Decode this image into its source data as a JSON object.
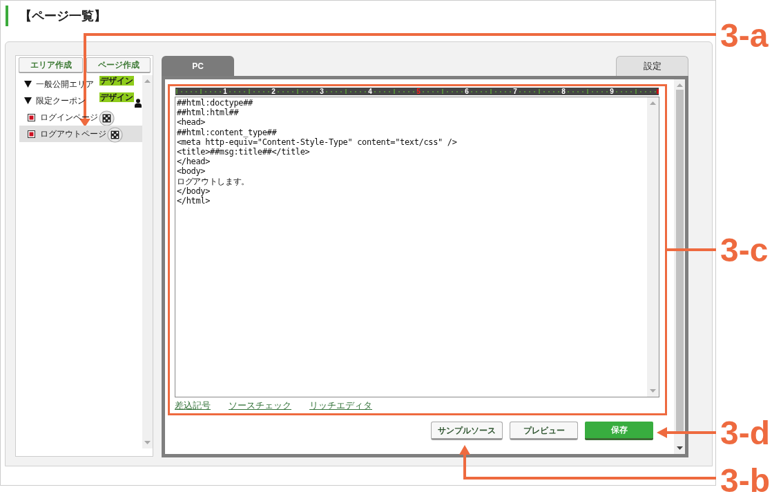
{
  "page_title": "【ページ一覧】",
  "sidebar": {
    "buttons": [
      "エリア作成",
      "ページ作成"
    ],
    "tree": [
      {
        "kind": "folder",
        "label": "一般公開エリア",
        "expanded": true,
        "selected": false,
        "badge": "デザイン",
        "members_only": false
      },
      {
        "kind": "folder",
        "label": "限定クーポン",
        "expanded": true,
        "selected": false,
        "badge": "デザイン",
        "members_only": true,
        "children": [
          {
            "kind": "page",
            "label": "ログインページ",
            "selected": false
          },
          {
            "kind": "page",
            "label": "ログアウトページ",
            "selected": true
          }
        ]
      }
    ]
  },
  "editor": {
    "tabs": [
      {
        "label": "PC",
        "selected": true
      },
      {
        "label": "設定",
        "selected": false
      }
    ],
    "ruler": {
      "marks": [
        {
          "label": "1",
          "highlighted": false
        },
        {
          "label": "2",
          "highlighted": false
        },
        {
          "label": "3",
          "highlighted": false
        },
        {
          "label": "4",
          "highlighted": false
        },
        {
          "label": "5",
          "highlighted": true
        },
        {
          "label": "6",
          "highlighted": false
        },
        {
          "label": "7",
          "highlighted": false
        },
        {
          "label": "8",
          "highlighted": false
        },
        {
          "label": "9",
          "highlighted": false
        }
      ]
    },
    "code_lines": [
      "##html:doctype##",
      "##html:html##",
      "<head>",
      "##html:content_type##",
      "<meta http-equiv=\"Content-Style-Type\" content=\"text/css\" />",
      "<title>##msg:title##</title>",
      "</head>",
      "<body>",
      "ログアウトします。",
      "</body>",
      "</html>"
    ],
    "links": [
      "差込記号",
      "ソースチェック",
      "リッチエディタ"
    ],
    "buttons": [
      {
        "label": "サンプルソース",
        "kind": "secondary"
      },
      {
        "label": "プレビュー",
        "kind": "secondary"
      },
      {
        "label": "保存",
        "kind": "primary"
      }
    ]
  },
  "annotations": [
    {
      "label": "3-a"
    },
    {
      "label": "3-c"
    },
    {
      "label": "3-d"
    },
    {
      "label": "3-b"
    }
  ]
}
